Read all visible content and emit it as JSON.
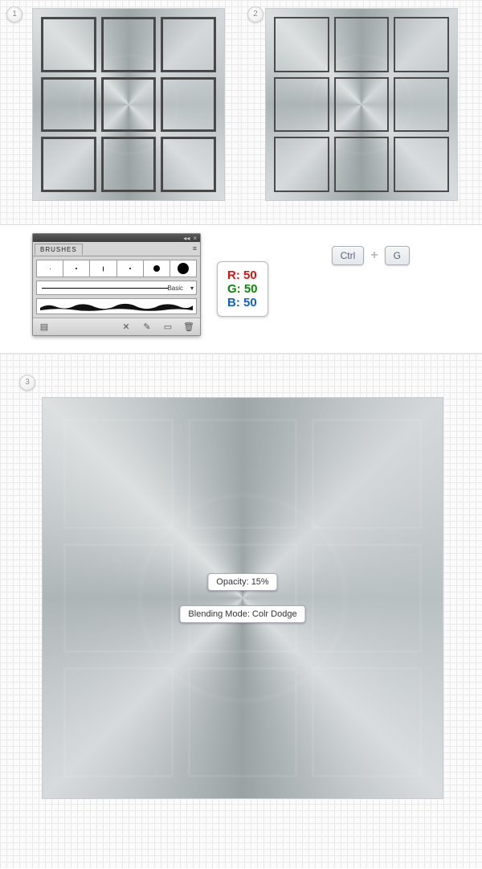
{
  "steps": {
    "one": "1",
    "two": "2",
    "three": "3"
  },
  "brushes": {
    "panel_title": "BRUSHES",
    "basic_label": "Basic",
    "topbar_collapse": "◂◂",
    "topbar_close": "×",
    "menu_icon": "≡",
    "dropdown_tri": "▾",
    "footer": {
      "lib": "▤",
      "remove": "✕",
      "opts": "✎",
      "new": "▭",
      "trash": "🗑"
    }
  },
  "rgb": {
    "r": "R: 50",
    "g": "G: 50",
    "b": "B: 50"
  },
  "shortcut": {
    "ctrl": "Ctrl",
    "plus": "+",
    "g": "G"
  },
  "overlay": {
    "opacity": "Opacity: 15%",
    "blend": "Blending Mode: Colr Dodge"
  }
}
